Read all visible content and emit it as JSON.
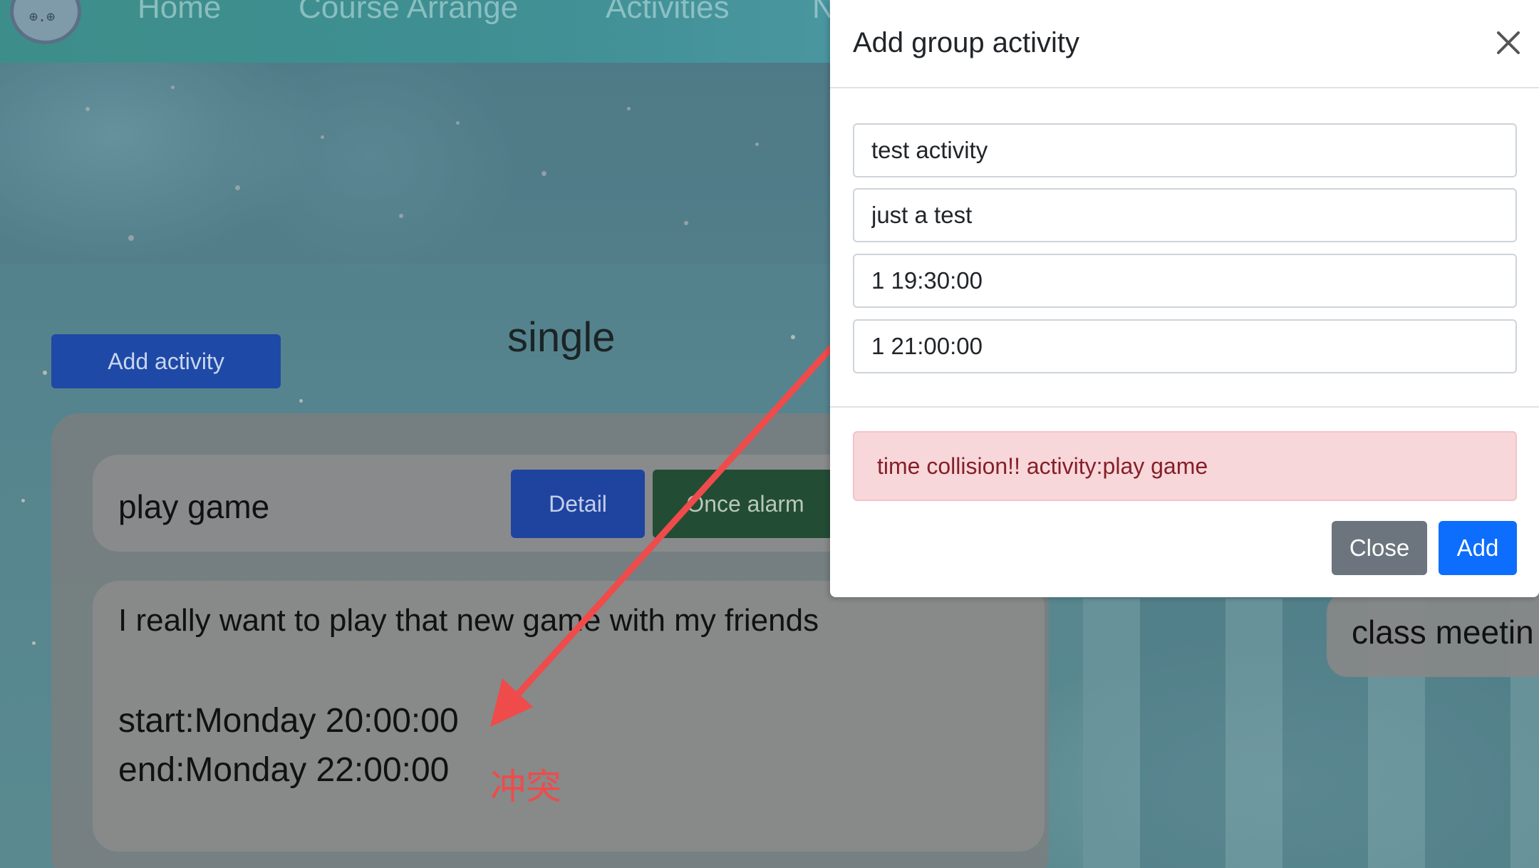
{
  "nav": {
    "items": [
      "Home",
      "Course Arrange",
      "Activities",
      "N"
    ]
  },
  "page": {
    "heading": "single",
    "add_activity_label": "Add activity"
  },
  "activity_card": {
    "title": "play game",
    "detail_label": "Detail",
    "alarm_label": "Once alarm",
    "description": "I really want to play that new game with my friends",
    "start": "start:Monday 20:00:00",
    "end": "end:Monday 22:00:00"
  },
  "side_card": {
    "title": "class meetin"
  },
  "annotation": {
    "text": "冲突",
    "color": "#ef4b4b"
  },
  "modal": {
    "title": "Add group activity",
    "fields": [
      {
        "value": "test activity"
      },
      {
        "value": "just a test"
      },
      {
        "value": "1 19:30:00"
      },
      {
        "value": "1 21:00:00"
      }
    ],
    "alert_text": "time collision!! activity:play game",
    "close_label": "Close",
    "add_label": "Add"
  },
  "colors": {
    "primary": "#0d6efd",
    "secondary": "#6c757d",
    "danger_bg": "#f8d7da",
    "danger_text": "#842029"
  }
}
